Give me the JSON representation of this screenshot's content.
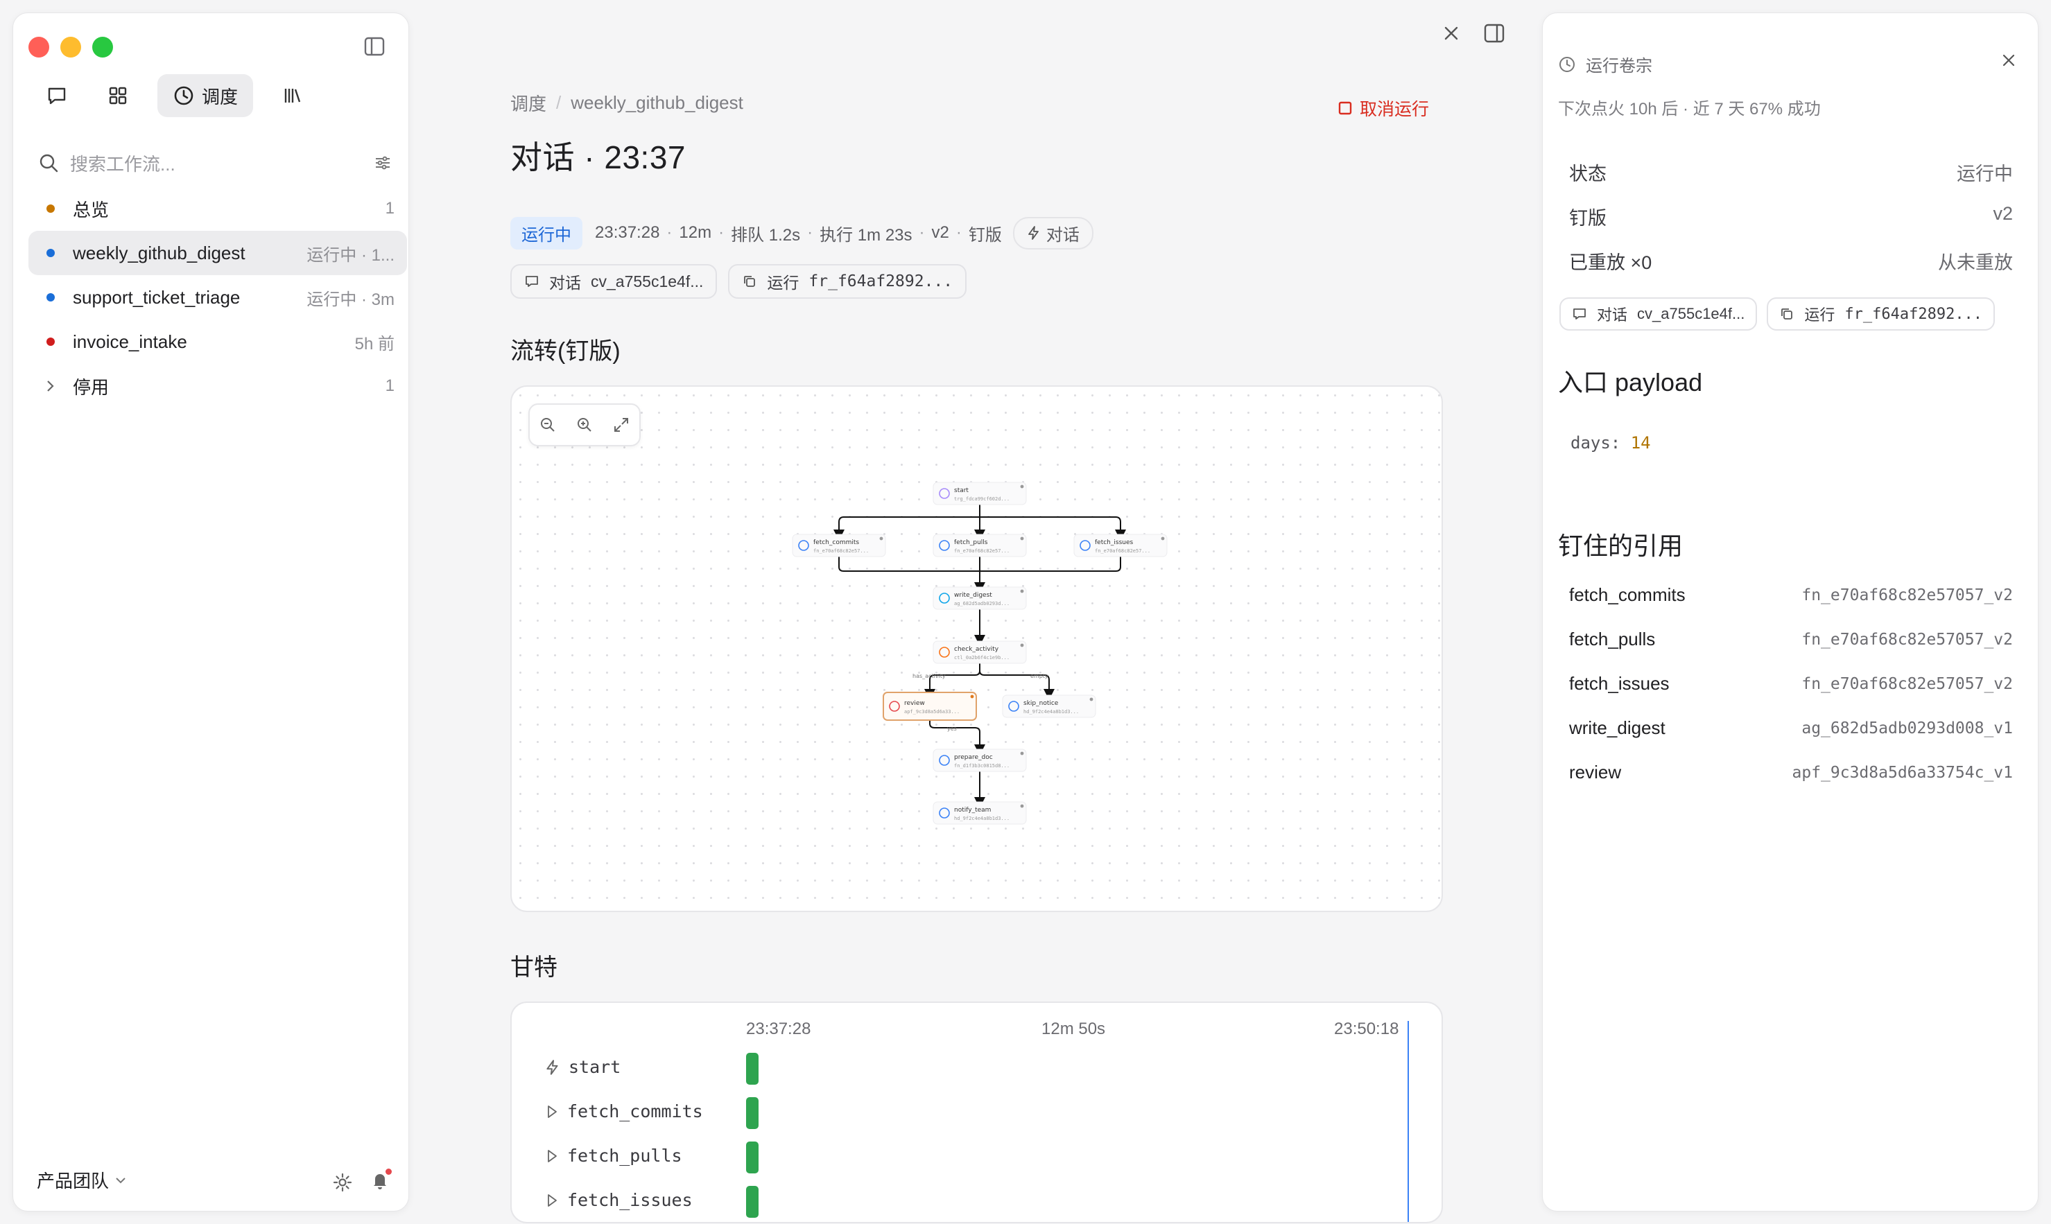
{
  "sidebar": {
    "nav": {
      "schedule_label": "调度"
    },
    "search_placeholder": "搜索工作流...",
    "items": [
      {
        "name": "总览",
        "meta": "1",
        "dot_color": "#c77700"
      },
      {
        "name": "weekly_github_digest",
        "meta": "运行中 · 1...",
        "dot_color": "#1a6ed8"
      },
      {
        "name": "support_ticket_triage",
        "meta": "运行中 · 3m",
        "dot_color": "#1a6ed8"
      },
      {
        "name": "invoice_intake",
        "meta": "5h 前",
        "dot_color": "#d01d1d"
      },
      {
        "name": "停用",
        "meta": "1"
      }
    ],
    "team": "产品团队"
  },
  "main": {
    "breadcrumb": {
      "root": "调度",
      "current": "weekly_github_digest"
    },
    "cancel_label": "取消运行",
    "title": "对话 · 23:37",
    "status": "运行中",
    "meta": {
      "start_time": "23:37:28",
      "duration": "12m",
      "queue": "排队 1.2s",
      "exec": "执行 1m 23s",
      "version": "v2",
      "pinned": "钉版",
      "trigger": "对话"
    },
    "chips": {
      "chat": {
        "label": "对话",
        "id": "cv_a755c1e4f..."
      },
      "run": {
        "label": "运行",
        "id": "fr_f64af2892..."
      }
    },
    "flow_title": "流转(钉版)",
    "flow_nodes": {
      "start": {
        "name": "start",
        "id": "trg_fdca99cf602d..."
      },
      "fetch_commits": {
        "name": "fetch_commits",
        "id": "fn_e70af68c82e57..."
      },
      "fetch_pulls": {
        "name": "fetch_pulls",
        "id": "fn_e70af68c82e57..."
      },
      "fetch_issues": {
        "name": "fetch_issues",
        "id": "fn_e70af68c82e57..."
      },
      "write_digest": {
        "name": "write_digest",
        "id": "ag_682d5adb0293d..."
      },
      "check_activity": {
        "name": "check_activity",
        "id": "ctl_0a2b6f4c1e9b..."
      },
      "review": {
        "name": "review",
        "id": "apf_9c3d8a5d6a33..."
      },
      "skip_notice": {
        "name": "skip_notice",
        "id": "hd_9f2c4e4a8b1d3..."
      },
      "prepare_doc": {
        "name": "prepare_doc",
        "id": "fn_d1f3b3c0815d8..."
      },
      "notify_team": {
        "name": "notify_team",
        "id": "hd_9f2c4e4a8b1d3..."
      }
    },
    "flow_edges": {
      "has_activity": "has_activity",
      "empty": "empty",
      "yes": "yes"
    },
    "gantt_title": "甘特",
    "gantt": {
      "axis": [
        "23:37:28",
        "12m 50s",
        "23:50:18"
      ],
      "rows": [
        "start",
        "fetch_commits",
        "fetch_pulls",
        "fetch_issues"
      ]
    }
  },
  "panel": {
    "title": "运行卷宗",
    "subtitle": "下次点火 10h 后 · 近 7 天 67% 成功",
    "props": [
      {
        "key": "状态",
        "value": "运行中"
      },
      {
        "key": "钉版",
        "value": "v2"
      },
      {
        "key": "已重放 ×0",
        "value": "从未重放"
      }
    ],
    "chips": {
      "chat": {
        "label": "对话",
        "id": "cv_a755c1e4f..."
      },
      "run": {
        "label": "运行",
        "id": "fr_f64af2892..."
      }
    },
    "payload_title": "入口 payload",
    "payload": {
      "key": "days:",
      "value": "14"
    },
    "refs_title": "钉住的引用",
    "refs": [
      {
        "name": "fetch_commits",
        "id": "fn_e70af68c82e57057_v2"
      },
      {
        "name": "fetch_pulls",
        "id": "fn_e70af68c82e57057_v2"
      },
      {
        "name": "fetch_issues",
        "id": "fn_e70af68c82e57057_v2"
      },
      {
        "name": "write_digest",
        "id": "ag_682d5adb0293d008_v1"
      },
      {
        "name": "review",
        "id": "apf_9c3d8a5d6a33754c_v1"
      }
    ]
  },
  "colors": {
    "running": "#1d67d6",
    "danger": "#d92d20",
    "success_bar": "#2ea44f",
    "now_line": "#3b82f6",
    "review_border": "#e0a26a"
  }
}
